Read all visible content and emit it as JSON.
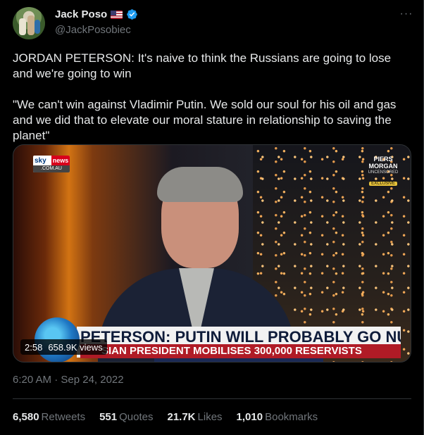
{
  "author": {
    "display_name": "Jack Poso",
    "handle": "@JackPosobiec",
    "flag": "us-flag-icon",
    "verified": true
  },
  "more_icon": "···",
  "tweet": {
    "text": "JORDAN PETERSON: It's naive to think the Russians are going to lose and we're going to win\n\n\"We can't win against Vladimir Putin. We sold our soul for his oil and gas and we did that to elevate our moral stature in relationship to saving the planet\""
  },
  "media": {
    "sky_text": "sky",
    "news_text": "news",
    "domain_text": ".COM.AU",
    "show_line1": "PIERS",
    "show_line2": "MORGAN",
    "show_line3": "UNCENSORED",
    "exclusive": "EXCLUSIVE",
    "headline1": "PETERSON: PUTIN WILL PROBABLY GO NUCLEAR",
    "headline2": "SIAN PRESIDENT MOBILISES 300,000 RESERVISTS",
    "duration": "2:58",
    "views": "658.9K views"
  },
  "timestamp": "6:20 AM · Sep 24, 2022",
  "stats": [
    {
      "value": "6,580",
      "label": "Retweets"
    },
    {
      "value": "551",
      "label": "Quotes"
    },
    {
      "value": "21.7K",
      "label": "Likes"
    },
    {
      "value": "1,010",
      "label": "Bookmarks"
    }
  ],
  "colors": {
    "background": "#000000",
    "text": "#e7e9ea",
    "muted": "#71767b",
    "verified": "#1d9bf0",
    "border": "#2f3336"
  }
}
